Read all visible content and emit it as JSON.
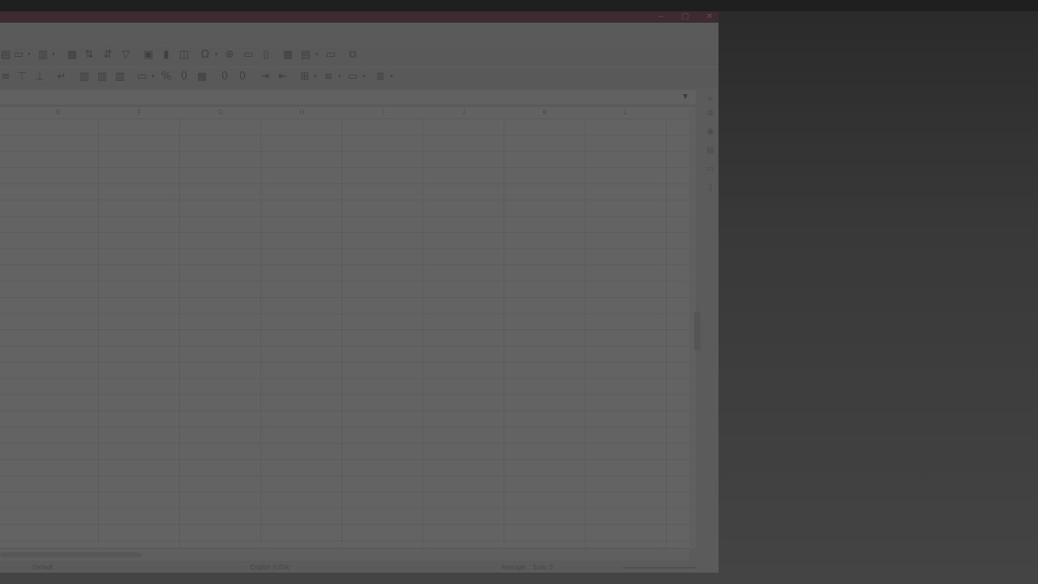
{
  "window": {
    "title_buttons": [
      "minimize",
      "maximize",
      "close"
    ]
  },
  "toolbar1": {
    "icons": [
      "row-icon",
      "column-icon",
      "freeze-icon",
      "sort-icon",
      "sort-asc-desc-icon",
      "filter-icon",
      "image-icon",
      "chart-icon",
      "pivot-icon",
      "special-char-icon",
      "hyperlink-icon",
      "comment-icon",
      "header-footer-icon",
      "define-print-area-icon",
      "freeze-rows-icon",
      "split-window-icon",
      "show-draw-icon"
    ]
  },
  "toolbar2": {
    "icons": [
      "align-left-icon",
      "align-center-icon",
      "align-right-icon",
      "wrap-icon",
      "merge-icon",
      "merge2-icon",
      "merge3-icon",
      "currency-icon",
      "percent-icon",
      "number-format-icon",
      "date-format-icon",
      "add-decimal-icon",
      "delete-decimal-icon",
      "increase-indent-icon",
      "decrease-indent-icon",
      "borders-icon",
      "border-style-icon",
      "border-color-icon",
      "cond-format-icon"
    ]
  },
  "columns": [
    "E",
    "F",
    "G",
    "H",
    "I",
    "J",
    "K",
    "L"
  ],
  "statusbar": {
    "page_style": "Default",
    "language": "English (USA)",
    "summary": "Average: ; Sum: 0"
  }
}
